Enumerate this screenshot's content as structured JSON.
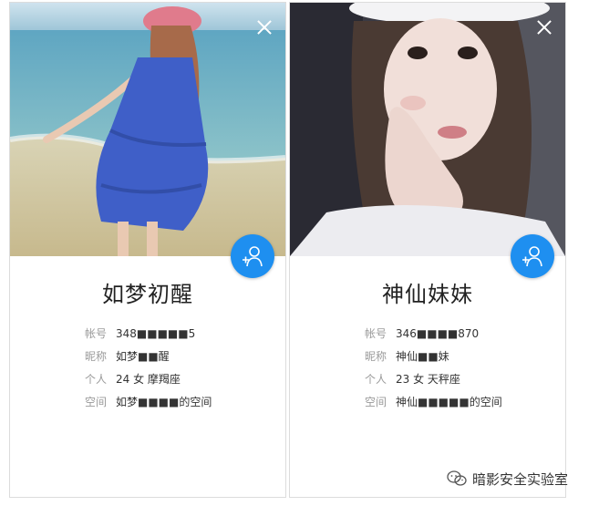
{
  "profiles": [
    {
      "nickname": "如梦初醒",
      "fields": [
        {
          "label": "帐号",
          "value": "348■■■■■5"
        },
        {
          "label": "昵称",
          "value": "如梦■■醒"
        },
        {
          "label": "个人",
          "value": "24  女  摩羯座"
        },
        {
          "label": "空间",
          "value": "如梦■■■■的空间"
        }
      ]
    },
    {
      "nickname": "神仙妹妹",
      "fields": [
        {
          "label": "帐号",
          "value": "346■■■■870"
        },
        {
          "label": "昵称",
          "value": "神仙■■妹"
        },
        {
          "label": "个人",
          "value": "23  女  天秤座"
        },
        {
          "label": "空间",
          "value": "神仙■■■■■的空间"
        }
      ]
    }
  ],
  "watermark": {
    "text": "暗影安全实验室",
    "icon": "wechat-icon"
  },
  "colors": {
    "accent": "#1e8ff0",
    "label": "#9a9a9a",
    "text": "#333333"
  }
}
